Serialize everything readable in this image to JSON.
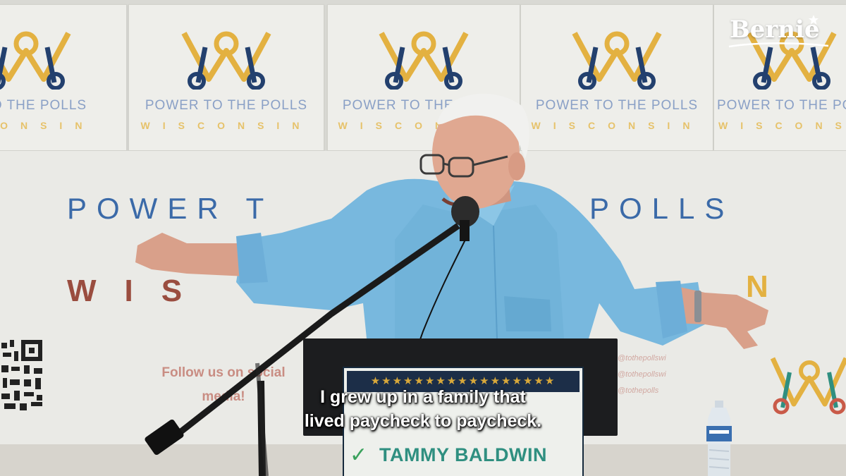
{
  "posters": {
    "line1": "POWER TO THE POLLS",
    "line2": "WISCONSIN"
  },
  "banner": {
    "title_left": "POWER T",
    "title_right": "POLLS",
    "state_left": "WIS",
    "state_right": "N",
    "follow_text": "Follow us on social media!",
    "handles": [
      "@tothepollswi",
      "@tothepollswi",
      "@tothepolls"
    ]
  },
  "watermark": {
    "text": "Bernie"
  },
  "podium_sign": {
    "stars": "★★★★★★★★★★★★★★★★★",
    "name": "TAMMY BALDWIN",
    "check": "✓"
  },
  "caption": {
    "line1": "I grew up in a family that",
    "line2": "lived paycheck to paycheck."
  },
  "colors": {
    "banner_blue": "#3b6aa8",
    "banner_gold": "#e3b141",
    "banner_maroon": "#9a4d3f",
    "shirt_blue": "#78b8de",
    "sign_navy": "#1c2e48",
    "sign_green": "#2f8f80"
  }
}
